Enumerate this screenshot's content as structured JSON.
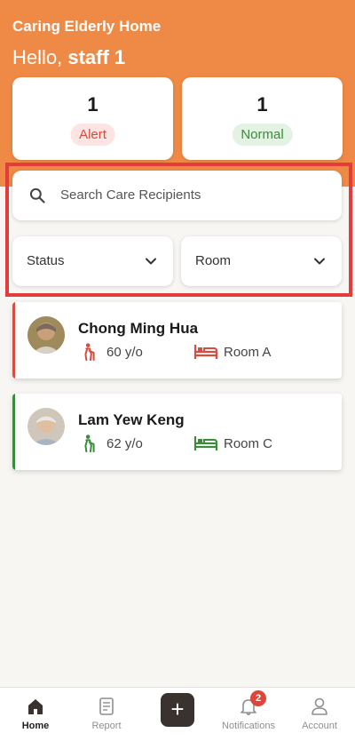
{
  "header": {
    "app_title": "Caring Elderly Home",
    "greeting_prefix": "Hello,",
    "user_name": "staff 1"
  },
  "stats": [
    {
      "count": "1",
      "label": "Alert"
    },
    {
      "count": "1",
      "label": "Normal"
    }
  ],
  "search": {
    "placeholder": "Search Care Recipients"
  },
  "filters": {
    "status_label": "Status",
    "room_label": "Room"
  },
  "recipients": [
    {
      "name": "Chong Ming Hua",
      "age": "60 y/o",
      "room": "Room A",
      "status": "alert"
    },
    {
      "name": "Lam Yew Keng",
      "age": "62 y/o",
      "room": "Room C",
      "status": "normal"
    }
  ],
  "nav": {
    "items": [
      {
        "label": "Home",
        "icon": "home-icon"
      },
      {
        "label": "Report",
        "icon": "report-icon"
      },
      {
        "label": "",
        "icon": "plus-icon"
      },
      {
        "label": "Notifications",
        "icon": "bell-icon"
      },
      {
        "label": "Account",
        "icon": "account-icon"
      }
    ],
    "notification_count": "2",
    "add_symbol": "+"
  },
  "colors": {
    "header": "#ee8a45",
    "alert": "#d84b3f",
    "normal": "#3c8b3c",
    "highlight_border": "#e23c3c"
  }
}
